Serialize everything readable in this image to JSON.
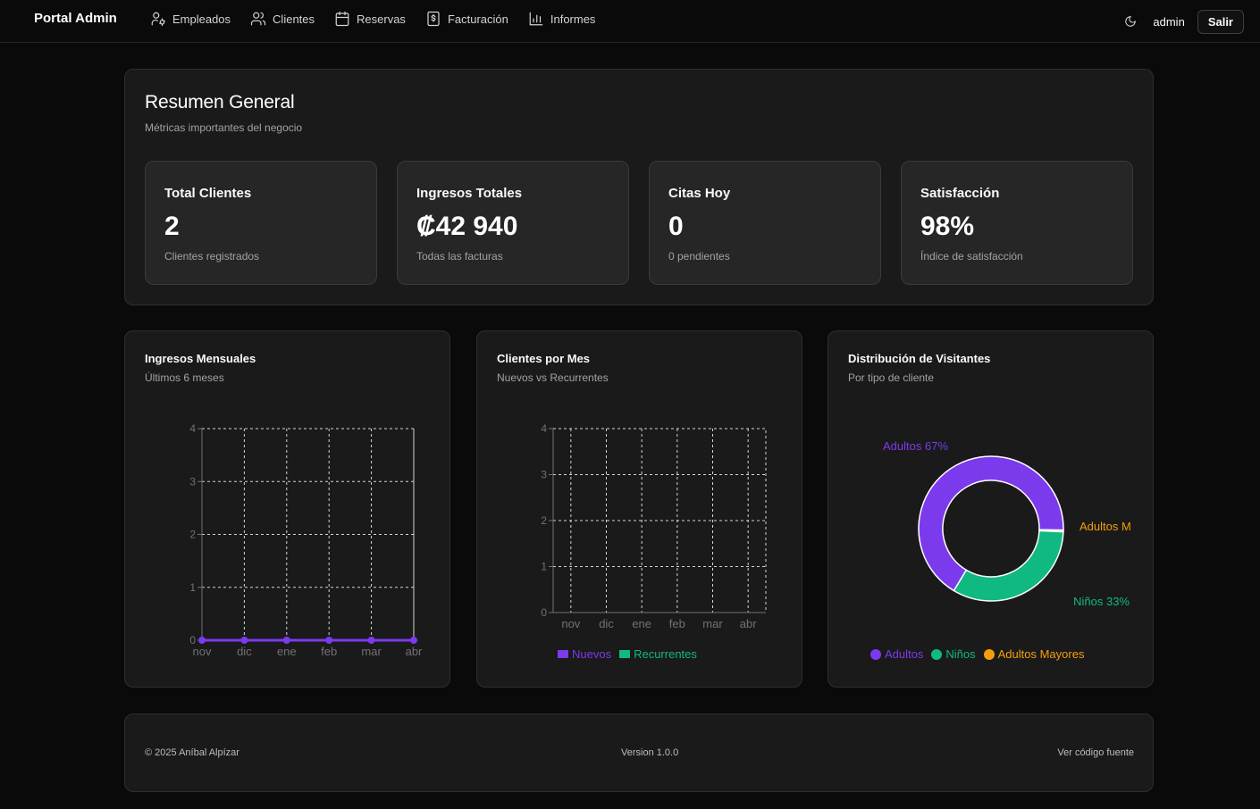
{
  "nav": {
    "brand": "Portal Admin",
    "links": [
      {
        "label": "Empleados",
        "icon": "user-cog-icon"
      },
      {
        "label": "Clientes",
        "icon": "users-icon"
      },
      {
        "label": "Reservas",
        "icon": "calendar-icon"
      },
      {
        "label": "Facturación",
        "icon": "receipt-icon"
      },
      {
        "label": "Informes",
        "icon": "bar-chart-icon"
      }
    ],
    "theme_icon": "moon-icon",
    "username": "admin",
    "logout_label": "Salir"
  },
  "summary": {
    "title": "Resumen General",
    "subtitle": "Métricas importantes del negocio",
    "stats": [
      {
        "title": "Total Clientes",
        "value": "2",
        "desc": "Clientes registrados"
      },
      {
        "title": "Ingresos Totales",
        "value": "₡42 940",
        "desc": "Todas las facturas"
      },
      {
        "title": "Citas Hoy",
        "value": "0",
        "desc": "0 pendientes"
      },
      {
        "title": "Satisfacción",
        "value": "98%",
        "desc": "Índice de satisfacción"
      }
    ]
  },
  "charts": {
    "revenue": {
      "title": "Ingresos Mensuales",
      "subtitle": "Últimos 6 meses"
    },
    "clients": {
      "title": "Clientes por Mes",
      "subtitle": "Nuevos vs Recurrentes",
      "legend": [
        "Nuevos",
        "Recurrentes"
      ]
    },
    "visitors": {
      "title": "Distribución de Visitantes",
      "subtitle": "Por tipo de cliente",
      "legend": [
        "Adultos",
        "Niños",
        "Adultos Mayores"
      ]
    }
  },
  "colors": {
    "purple": "#7c3aed",
    "green": "#10b981",
    "orange": "#f59e0b",
    "axis": "#71717a"
  },
  "chart_data": [
    {
      "type": "line",
      "title": "Ingresos Mensuales",
      "categories": [
        "nov",
        "dic",
        "ene",
        "feb",
        "mar",
        "abr"
      ],
      "series": [
        {
          "values": [
            0,
            0,
            0,
            0,
            0,
            0
          ]
        }
      ],
      "yticks": [
        "0",
        "1",
        "2",
        "3",
        "4"
      ],
      "ylim": [
        0,
        4
      ],
      "grid": true
    },
    {
      "type": "bar",
      "title": "Clientes por Mes",
      "categories": [
        "nov",
        "dic",
        "ene",
        "feb",
        "mar",
        "abr"
      ],
      "series": [
        {
          "name": "Nuevos",
          "values": [
            0,
            0,
            0,
            0,
            0,
            0
          ]
        },
        {
          "name": "Recurrentes",
          "values": [
            0,
            0,
            0,
            0,
            0,
            0
          ]
        }
      ],
      "yticks": [
        "0",
        "1",
        "2",
        "3",
        "4"
      ],
      "ylim": [
        0,
        4
      ],
      "grid": true,
      "legend": "bottom"
    },
    {
      "type": "pie",
      "title": "Distribución de Visitantes",
      "slices": [
        {
          "name": "Adultos",
          "value": 67,
          "label": "Adultos 67%"
        },
        {
          "name": "Niños",
          "value": 33,
          "label": "Niños 33%"
        },
        {
          "name": "Adultos Mayores",
          "value": 0.4,
          "label": "Adultos M"
        }
      ],
      "legend": "bottom"
    }
  ],
  "footer": {
    "copyright": "© 2025 Aníbal Alpízar",
    "version": "Version 1.0.0",
    "source": "Ver código fuente"
  }
}
